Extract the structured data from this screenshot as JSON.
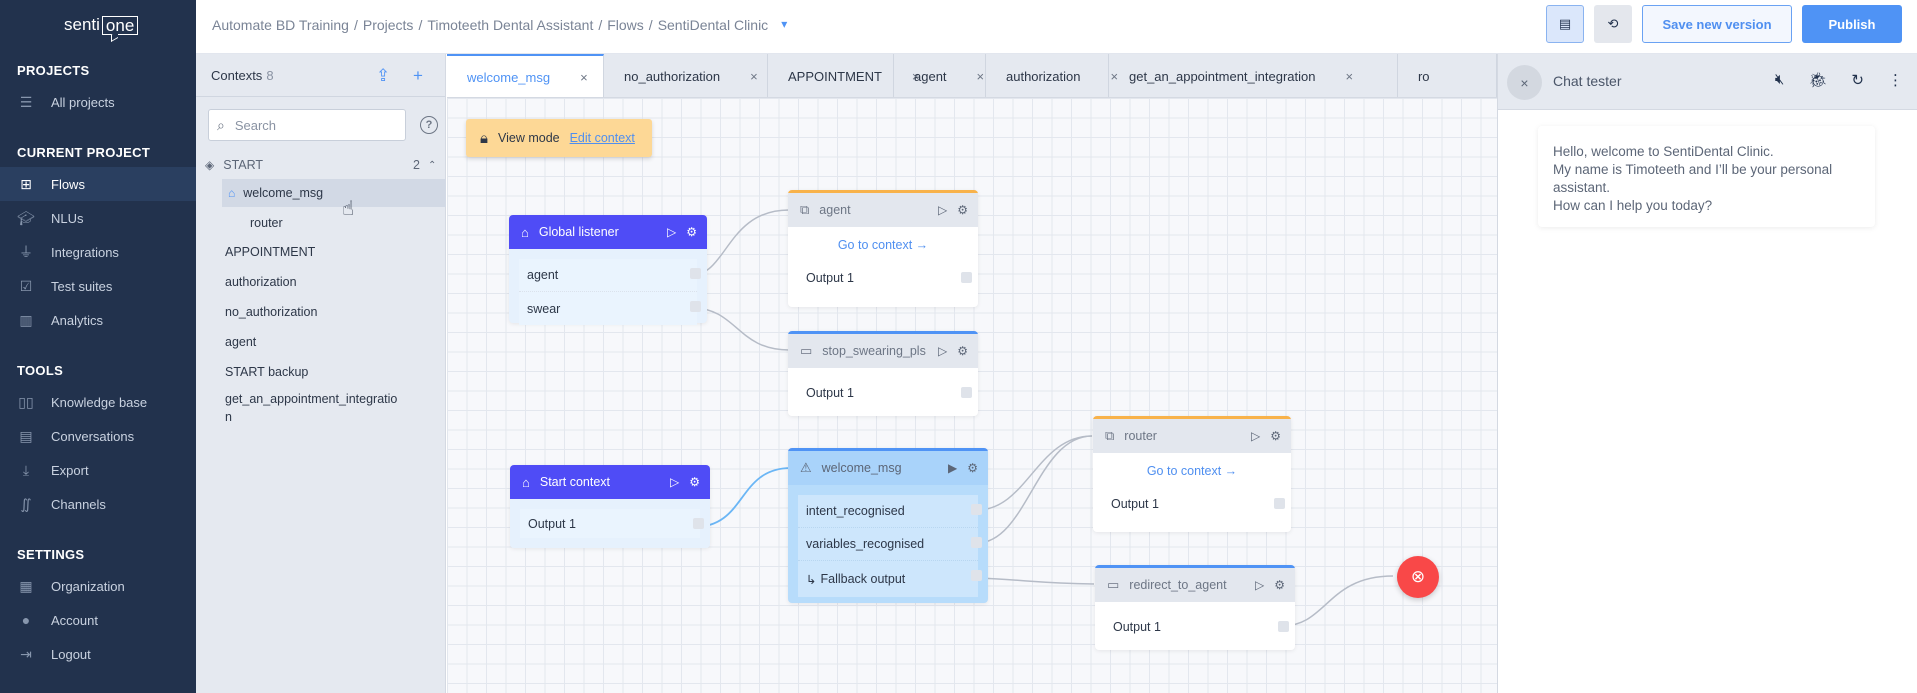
{
  "nav": {
    "logo": {
      "left": "senti",
      "right": "one"
    },
    "sections": [
      {
        "title": "PROJECTS",
        "items": [
          {
            "label": "All projects",
            "icon": "list-icon"
          }
        ]
      },
      {
        "title": "CURRENT PROJECT",
        "items": [
          {
            "label": "Flows",
            "icon": "flows-icon",
            "active": true
          },
          {
            "label": "NLUs",
            "icon": "graduation-cap-icon"
          },
          {
            "label": "Integrations",
            "icon": "plug-icon"
          },
          {
            "label": "Test suites",
            "icon": "test-suite-icon"
          },
          {
            "label": "Analytics",
            "icon": "analytics-icon"
          }
        ]
      },
      {
        "title": "TOOLS",
        "items": [
          {
            "label": "Knowledge base",
            "icon": "book-icon"
          },
          {
            "label": "Conversations",
            "icon": "chat-icon"
          },
          {
            "label": "Export",
            "icon": "download-icon"
          },
          {
            "label": "Channels",
            "icon": "channels-icon"
          }
        ]
      },
      {
        "title": "SETTINGS",
        "items": [
          {
            "label": "Organization",
            "icon": "building-icon"
          },
          {
            "label": "Account",
            "icon": "user-icon"
          },
          {
            "label": "Logout",
            "icon": "logout-icon"
          }
        ]
      }
    ]
  },
  "header": {
    "breadcrumb": [
      "Automate BD Training",
      "Projects",
      "Timoteeth Dental Assistant",
      "Flows",
      "SentiDental Clinic"
    ],
    "separator": "/",
    "save_label": "Save new version",
    "publish_label": "Publish"
  },
  "contexts": {
    "title": "Contexts",
    "count": "8",
    "search_placeholder": "Search",
    "group": {
      "label": "START",
      "count": "2",
      "children": [
        "welcome_msg",
        "router"
      ]
    },
    "items": [
      "APPOINTMENT",
      "authorization",
      "no_authorization",
      "agent",
      "START backup",
      "get_an_appointment_integratio",
      "n"
    ]
  },
  "tabs": [
    {
      "label": "welcome_msg",
      "active": true
    },
    {
      "label": "no_authorization"
    },
    {
      "label": "APPOINTMENT"
    },
    {
      "label": "agent"
    },
    {
      "label": "authorization"
    },
    {
      "label": "get_an_appointment_integration"
    },
    {
      "label": "ro"
    }
  ],
  "canvas": {
    "view_mode_label": "View mode",
    "edit_context_label": "Edit context",
    "go_to_context": "Go to context →",
    "nodes": {
      "global_listener": {
        "title": "Global listener",
        "outputs": [
          "agent",
          "swear"
        ]
      },
      "agent": {
        "title": "agent",
        "outputs": [
          "Output 1"
        ]
      },
      "stop_swearing": {
        "title": "stop_swearing_pls",
        "outputs": [
          "Output 1"
        ]
      },
      "start_context": {
        "title": "Start context",
        "outputs": [
          "Output 1"
        ]
      },
      "welcome_msg": {
        "title": "welcome_msg",
        "outputs": [
          "intent_recognised",
          "variables_recognised",
          "Fallback output"
        ]
      },
      "router": {
        "title": "router",
        "outputs": [
          "Output 1"
        ]
      },
      "redirect": {
        "title": "redirect_to_agent",
        "outputs": [
          "Output 1"
        ]
      }
    }
  },
  "chat": {
    "title": "Chat tester",
    "message": [
      "Hello, welcome to SentiDental Clinic.",
      "My name is Timoteeth and I’ll be your personal",
      "assistant.",
      "How can I help you today?"
    ]
  },
  "colors": {
    "accent": "#4f93f5",
    "nav_bg": "#22324d",
    "listener": "#4f4cf6",
    "end_node": "#f94848",
    "view_mode": "#fdd896"
  }
}
